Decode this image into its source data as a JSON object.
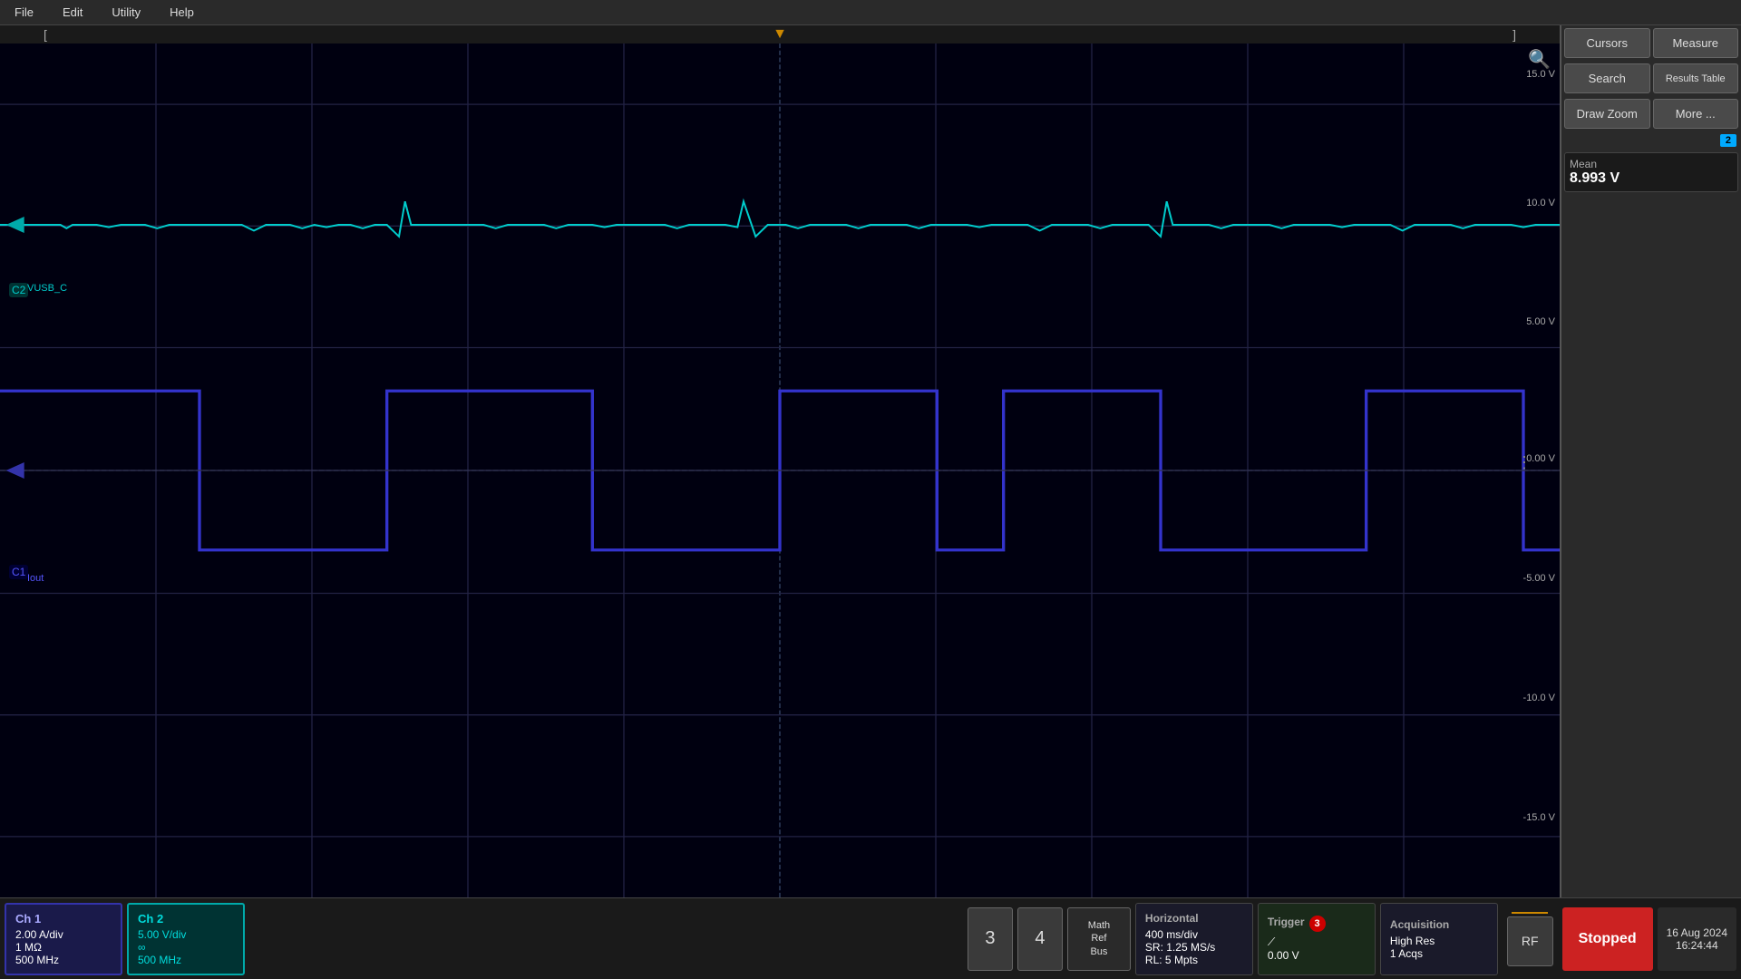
{
  "menu": {
    "file": "File",
    "edit": "Edit",
    "utility": "Utility",
    "help": "Help"
  },
  "right_panel": {
    "cursors_btn": "Cursors",
    "measure_btn": "Measure",
    "search_btn": "Search",
    "results_table_btn": "Results Table",
    "draw_zoom_btn": "Draw Zoom",
    "more_btn": "More ...",
    "ch2_badge": "2",
    "measurement_label": "Mean",
    "measurement_value": "8.993 V"
  },
  "voltage_labels": [
    "15.0 V",
    "10.0 V",
    "5.00 V",
    "0.00 V",
    "-5.00 V",
    "-10.0 V",
    "-15.0 V"
  ],
  "channels": {
    "ch1": {
      "title": "Ch 1",
      "vdiv": "2.00 A/div",
      "resistance": "1 MΩ",
      "bandwidth": "500 MHz",
      "label": "Iout"
    },
    "ch2": {
      "title": "Ch 2",
      "vdiv": "5.00 V/div",
      "coupling_icon": "∞",
      "bandwidth": "500 MHz",
      "label": "VUSB_C"
    }
  },
  "buttons": {
    "num3": "3",
    "num4": "4",
    "math_ref_bus": "Math\nRef\nBus"
  },
  "horizontal": {
    "title": "Horizontal",
    "msdiv": "400 ms/div",
    "sr": "SR: 1.25 MS/s",
    "rl": "RL: 5 Mpts"
  },
  "trigger": {
    "title": "Trigger",
    "badge": "3",
    "symbol": "⟋",
    "value": "0.00 V"
  },
  "acquisition": {
    "title": "Acquisition",
    "mode": "High Res",
    "acqs": "1 Acqs"
  },
  "rf_label": "RF",
  "stopped_label": "Stopped",
  "datetime": {
    "date": "16 Aug 2024",
    "time": "16:24:44"
  }
}
